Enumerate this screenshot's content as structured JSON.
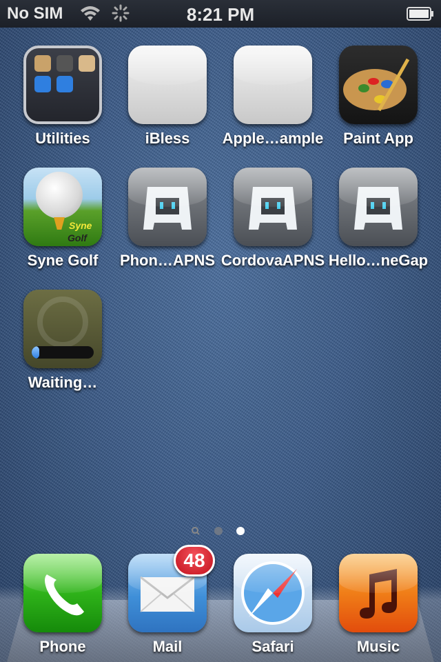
{
  "status_bar": {
    "carrier": "No SIM",
    "time": "8:21 PM",
    "wifi_icon": "wifi-icon",
    "activity_icon": "activity-spinner-icon",
    "battery_icon": "battery-icon"
  },
  "apps": [
    {
      "label": "Utilities",
      "icon": "utilities-folder-icon"
    },
    {
      "label": "iBless",
      "icon": "blank-app-icon"
    },
    {
      "label": "Apple…ample",
      "icon": "blank-app-icon"
    },
    {
      "label": "Paint App",
      "icon": "paint-palette-icon"
    },
    {
      "label": "Syne Golf",
      "icon": "golf-ball-icon",
      "icon_text_1": "Syne",
      "icon_text_2": "Golf"
    },
    {
      "label": "Phon…APNS",
      "icon": "cordova-icon"
    },
    {
      "label": "CordovaAPNS",
      "icon": "cordova-icon"
    },
    {
      "label": "Hello…neGap",
      "icon": "cordova-icon"
    },
    {
      "label": "Waiting…",
      "icon": "waiting-install-icon",
      "progress": 0.12
    }
  ],
  "page_indicator": {
    "pages": 3,
    "current": 3,
    "search_icon": "spotlight-search-icon"
  },
  "dock": [
    {
      "label": "Phone",
      "icon": "phone-icon"
    },
    {
      "label": "Mail",
      "icon": "mail-icon",
      "badge": "48"
    },
    {
      "label": "Safari",
      "icon": "safari-compass-icon"
    },
    {
      "label": "Music",
      "icon": "music-note-icon"
    }
  ]
}
